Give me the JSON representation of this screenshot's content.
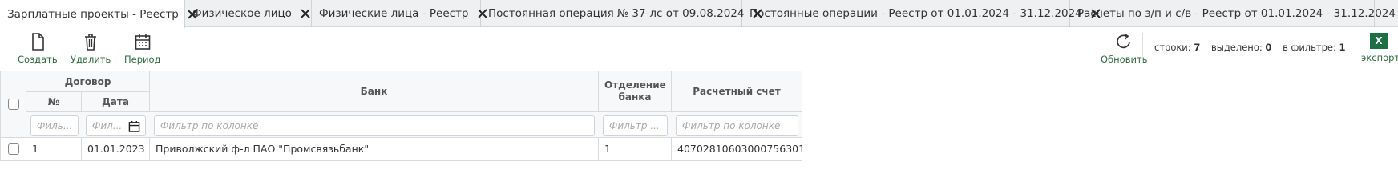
{
  "tabs": [
    {
      "label": "Зарплатные проекты - Реестр"
    },
    {
      "label": "Физическое лицо"
    },
    {
      "label": "Физические лица - Реестр"
    },
    {
      "label": "Постоянная операция № 37-лс от 09.08.2024"
    },
    {
      "label": "Постоянные операции - Реестр от 01.01.2024 - 31.12.2024"
    },
    {
      "label": "Расчеты по з/п и с/в - Реестр от 01.01.2024 - 31.12.2024"
    }
  ],
  "toolbar": {
    "create_label": "Создать",
    "delete_label": "Удалить",
    "period_label": "Период",
    "refresh_label": "Обновить",
    "export_label": "экспорт",
    "excel_glyph": "X"
  },
  "stats": {
    "rows_label": "строки:",
    "rows_value": "7",
    "selected_label": "выделено:",
    "selected_value": "0",
    "filter_label": "в фильтре:",
    "filter_value": "1"
  },
  "grid": {
    "group_header": "Договор",
    "columns": {
      "num": "№",
      "date": "Дата",
      "bank": "Банк",
      "branch": "Отделение банка",
      "account": "Расчетный счет"
    },
    "filters": {
      "num": "Филь...",
      "date": "Фил...",
      "bank": "Фильтр по колонке",
      "branch": "Фильтр ...",
      "account": "Фильтр по колонке"
    },
    "rows": [
      {
        "num": "1",
        "date": "01.01.2023",
        "bank": "Приволжский ф-л ПАО \"Промсвязьбанк\"",
        "branch": "1",
        "account": "40702810603000756301"
      }
    ]
  },
  "colors": {
    "accent": "#2f6b3c",
    "excel": "#1d7044"
  }
}
